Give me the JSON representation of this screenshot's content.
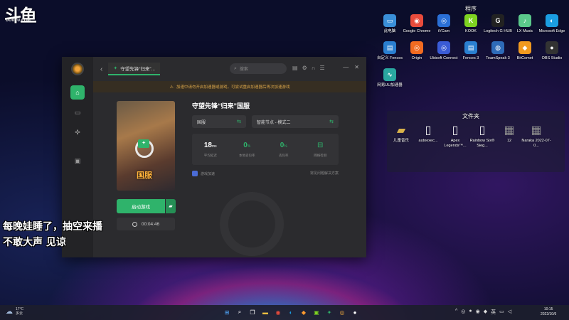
{
  "stream_logo": {
    "glyph": "斗鱼",
    "sub": "DOUYU.COM"
  },
  "desktop": {
    "programs_title": "程序",
    "programs": [
      {
        "label": "此电脑",
        "icon": "computer-icon",
        "color": "#3a8fd8"
      },
      {
        "label": "Google Chrome",
        "icon": "chrome-icon",
        "color": "#e84b3c"
      },
      {
        "label": "iVCam",
        "icon": "camera-icon",
        "color": "#2a6fd6"
      },
      {
        "label": "KOOK",
        "icon": "kook-icon",
        "color": "#7ed321"
      },
      {
        "label": "Logitech G HUB",
        "icon": "logitech-icon",
        "color": "#222222"
      },
      {
        "label": "LX Music",
        "icon": "music-icon",
        "color": "#5bc98b"
      },
      {
        "label": "Microsoft Edge",
        "icon": "edge-icon",
        "color": "#1b9de2"
      },
      {
        "label": "自定义 Fences",
        "icon": "fences-icon",
        "color": "#2a7fd0"
      },
      {
        "label": "Origin",
        "icon": "origin-icon",
        "color": "#f26b21"
      },
      {
        "label": "Ubisoft Connect",
        "icon": "ubisoft-icon",
        "color": "#3a5bd6"
      },
      {
        "label": "Fences 3",
        "icon": "fences-icon",
        "color": "#2a7fd0"
      },
      {
        "label": "TeamSpeak 3",
        "icon": "teamspeak-icon",
        "color": "#2e6bb8"
      },
      {
        "label": "BitComet",
        "icon": "bitcomet-icon",
        "color": "#f29a1f"
      },
      {
        "label": "OBS Studio",
        "icon": "obs-icon",
        "color": "#333333"
      },
      {
        "label": "网易UU加速器",
        "icon": "uu-icon",
        "color": "#2aa7a0"
      }
    ],
    "files_title": "文件夹",
    "files": [
      {
        "label": "儿童音乐",
        "icon": "folder-icon"
      },
      {
        "label": "autoexec...",
        "icon": "file-icon"
      },
      {
        "label": "Apex Legends™...",
        "icon": "file-icon"
      },
      {
        "label": "Rainbow Six® Sieg...",
        "icon": "file-icon"
      },
      {
        "label": "12",
        "icon": "image-icon"
      },
      {
        "label": "Naraka 2022-07-0...",
        "icon": "image-icon"
      }
    ]
  },
  "app": {
    "tab_label": "守望先锋“归来”...",
    "search_placeholder": "搜索",
    "notice": "加速中请勿开启加速器或游戏，可尝试重启加速器后再次加速游戏",
    "game_title": "守望先锋“归来”国服",
    "cover_region": "国服",
    "server_select": "国服",
    "node_select": "智能节点 - 模式二",
    "stats": [
      {
        "value": "18",
        "unit": "ms",
        "label": "平均延迟",
        "accent": false
      },
      {
        "value": "0",
        "unit": "%",
        "label": "本地丢包率",
        "accent": true
      },
      {
        "value": "0",
        "unit": "%",
        "label": "丢包率",
        "accent": true
      },
      {
        "value": "",
        "unit": "",
        "label": "网络检测",
        "accent": true
      }
    ],
    "boost_link": "游戏加速",
    "help_link": "常见问题解决方案",
    "launch_label": "启动游戏",
    "timer": "00:04:46"
  },
  "subtitle": {
    "line1": "每晚娃睡了，抽空来播",
    "line2": "不敢大声 见谅"
  },
  "taskbar": {
    "weather_temp": "17°C",
    "weather_desc": "多云",
    "ime": "英",
    "time": "10:15",
    "date": "2022/10/6"
  }
}
